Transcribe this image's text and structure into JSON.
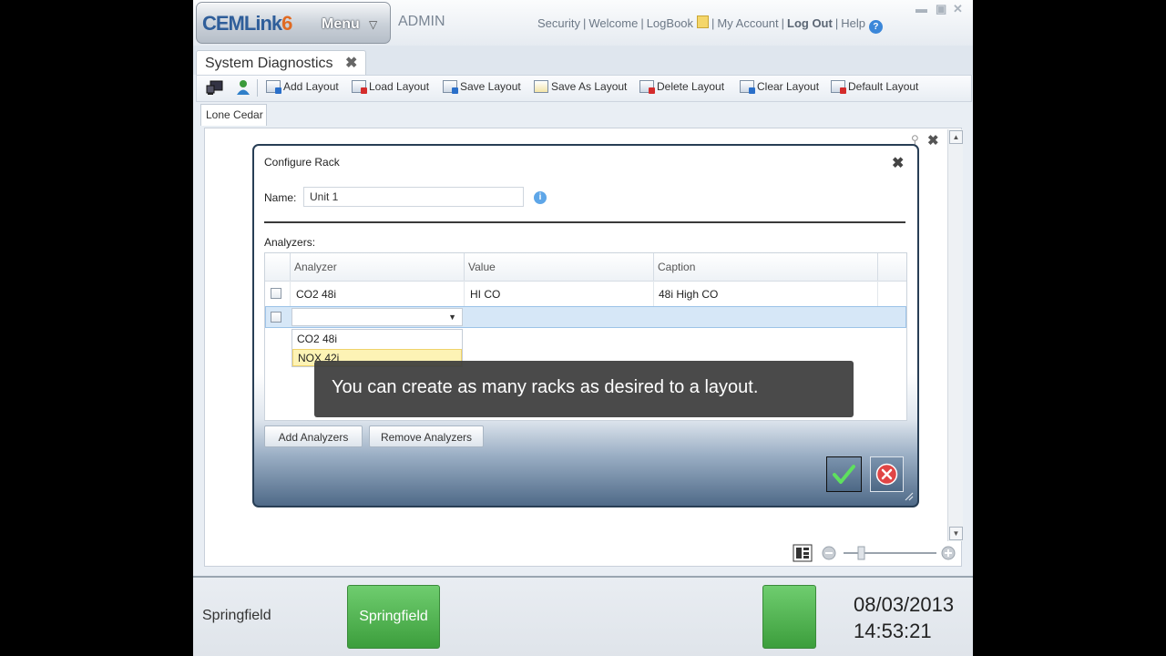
{
  "header": {
    "logo_part1": "CEMLink",
    "logo_part2": "6",
    "menu_label": "Menu",
    "role": "ADMIN",
    "links": {
      "security": "Security",
      "welcome": "Welcome",
      "logbook": "LogBook",
      "my_account": "My Account",
      "log_out": "Log Out",
      "help": "Help"
    },
    "separator": "|"
  },
  "document_tab": {
    "label": "System Diagnostics"
  },
  "toolbar": {
    "add_layout": "Add Layout",
    "load_layout": "Load Layout",
    "save_layout": "Save Layout",
    "save_as_layout": "Save As Layout",
    "delete_layout": "Delete Layout",
    "clear_layout": "Clear Layout",
    "default_layout": "Default Layout"
  },
  "layout_tab": {
    "label": "Lone Cedar"
  },
  "dialog": {
    "title": "Configure Rack",
    "name_label": "Name:",
    "name_value": "Unit 1",
    "analyzers_label": "Analyzers:",
    "columns": [
      "Analyzer",
      "Value",
      "Caption"
    ],
    "rows": [
      {
        "analyzer": "CO2 48i",
        "value": "HI CO",
        "caption": "48i High CO"
      }
    ],
    "dropdown_options": [
      "CO2 48i",
      "NOX 42i"
    ],
    "add_button": "Add Analyzers",
    "remove_button": "Remove Analyzers"
  },
  "overlay_caption": "You can create as many racks as desired to a layout.",
  "status": {
    "site_label": "Springfield",
    "site_button": "Springfield",
    "date": "08/03/2013",
    "time": "14:53:21"
  },
  "colors": {
    "status_green": "#4caf50",
    "dialog_border": "#283e55",
    "logo_blue": "#2f5e9a",
    "logo_orange": "#e06a22"
  }
}
